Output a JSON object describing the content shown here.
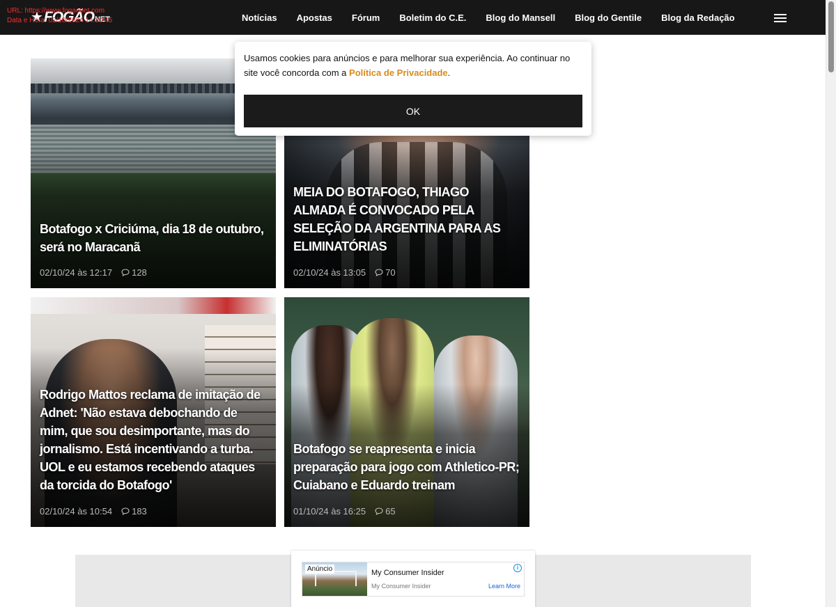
{
  "browser_overlay": {
    "url_line": "URL: https://www.fogaonet.com",
    "date_line": "Data e Hora: 02/10/2024 14:30:45"
  },
  "header": {
    "logo_main": "FOGÃO",
    "logo_suffix": "NET",
    "nav": [
      "Notícias",
      "Apostas",
      "Fórum",
      "Boletim do C.E.",
      "Blog do Mansell",
      "Blog do Gentile",
      "Blog da Redação"
    ]
  },
  "cookie": {
    "text_before": "Usamos cookies para anúncios e para melhorar sua experiência. Ao continuar no site você concorda com a ",
    "link": "Política de Privacidade",
    "text_after": ".",
    "ok": "OK",
    "link_color": "#d98b1c"
  },
  "articles": [
    {
      "title": "Botafogo x Criciúma, dia 18 de outubro, será no Maracanã",
      "date": "02/10/24 às 12:17",
      "comments": "128"
    },
    {
      "title": "MEIA DO BOTAFOGO, THIAGO ALMADA É CONVOCADO PELA SELEÇÃO DA ARGENTINA PARA AS ELIMINATÓRIAS",
      "date": "02/10/24 às 13:05",
      "comments": "70"
    },
    {
      "title": "Rodrigo Mattos reclama de imitação de Adnet: 'Não estava debochando de mim, que sou desimportante, mas do jornalismo. Está incentivando a turba. UOL e eu estamos recebendo ataques da torcida do Botafogo'",
      "date": "02/10/24 às 10:54",
      "comments": "183"
    },
    {
      "title": "Botafogo se reapresenta e inicia preparação para jogo com Athletico-PR; Cuiabano e Eduardo treinam",
      "date": "01/10/24 às 16:25",
      "comments": "65"
    }
  ],
  "ad": {
    "tag": "Anúncio",
    "title": "My Consumer Insider",
    "source": "My Consumer Insider",
    "cta": "Learn More"
  }
}
